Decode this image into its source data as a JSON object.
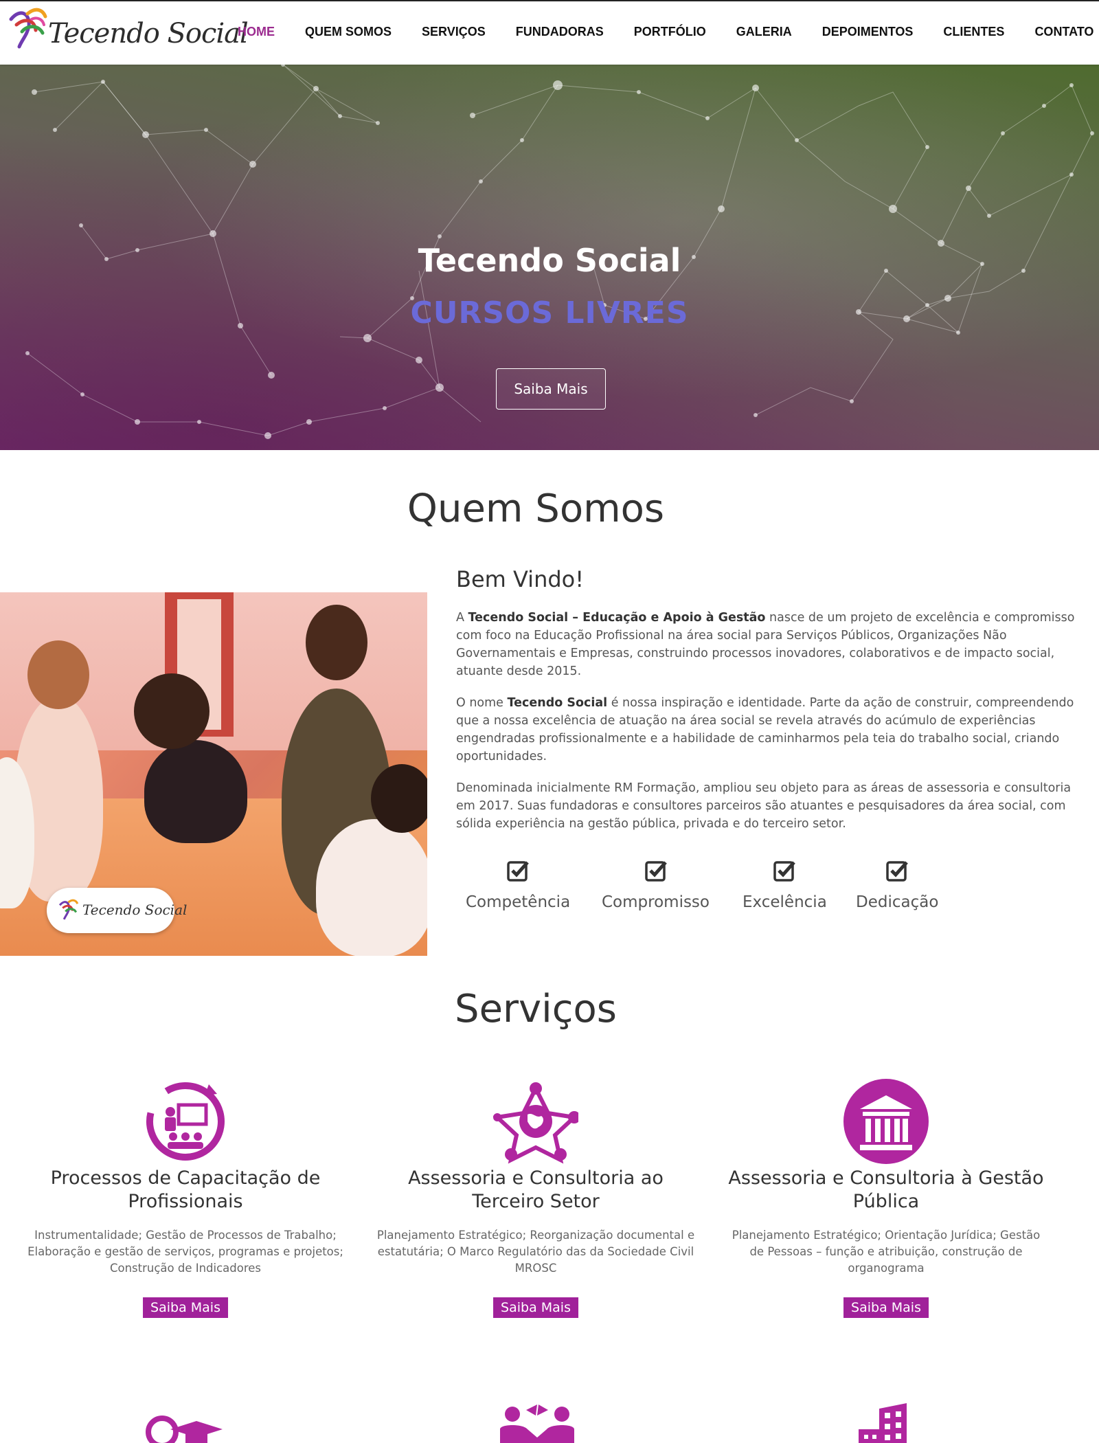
{
  "brand": {
    "name": "Tecendo Social",
    "accent": "#9b2b8f",
    "button_color": "#a0219a",
    "hero_sub_color": "#6b6ad8"
  },
  "nav": {
    "items": [
      {
        "label": "HOME",
        "active": true
      },
      {
        "label": "QUEM SOMOS",
        "active": false
      },
      {
        "label": "SERVIÇOS",
        "active": false
      },
      {
        "label": "FUNDADORAS",
        "active": false
      },
      {
        "label": "PORTFÓLIO",
        "active": false
      },
      {
        "label": "GALERIA",
        "active": false
      },
      {
        "label": "DEPOIMENTOS",
        "active": false
      },
      {
        "label": "CLIENTES",
        "active": false
      },
      {
        "label": "CONTATO",
        "active": false
      }
    ]
  },
  "hero": {
    "title": "Tecendo Social",
    "subtitle": "CURSOS LIVRES",
    "button": "Saiba Mais"
  },
  "quem_somos": {
    "title": "Quem Somos",
    "image_logo": "Tecendo Social",
    "welcome": "Bem Vindo!",
    "p1_pre": "A ",
    "p1_bold": "Tecendo Social – Educação e Apoio à Gestão",
    "p1_post": " nasce de um projeto de excelência e compromisso com foco na Educação Profissional na área social para Serviços Públicos, Organizações Não Governamentais e Empresas, construindo processos inovadores, colaborativos e de impacto social, atuante desde 2015.",
    "p2_pre": "O nome ",
    "p2_bold": "Tecendo Social",
    "p2_post": " é nossa inspiração e identidade. Parte da ação de construir, compreendendo que a nossa excelência de atuação na área social se revela através do acúmulo de experiências engendradas profissionalmente e a habilidade de caminharmos pela teia do trabalho social, criando oportunidades.",
    "p3": "Denominada inicialmente RM Formação, ampliou seu objeto para as áreas de assessoria e consultoria em 2017. Suas fundadoras e consultores parceiros são atuantes e pesquisadores da área social, com sólida experiência na gestão pública, privada e do terceiro setor.",
    "values": [
      "Competência",
      "Compromisso",
      "Excelência",
      "Dedicação"
    ]
  },
  "servicos": {
    "title": "Serviços",
    "items": [
      {
        "icon": "presentation-icon",
        "title": "Processos de Capacitação de Profissionais",
        "desc": "Instrumentalidade; Gestão de Processos de Trabalho; Elaboração e gestão de serviços, programas e projetos; Construção de Indicadores",
        "button": "Saiba Mais"
      },
      {
        "icon": "globe-people-icon",
        "title": "Assessoria e Consultoria ao Terceiro Setor",
        "desc": "Planejamento Estratégico; Reorganização documental e estatutária; O Marco Regulatório das da Sociedade Civil MROSC",
        "button": "Saiba Mais"
      },
      {
        "icon": "government-building-icon",
        "title": "Assessoria e Consultoria à Gestão Pública",
        "desc": "Planejamento Estratégico; Orientação Jurídica; Gestão de Pessoas – função e atribuição, construção de organograma",
        "button": "Saiba Mais"
      }
    ]
  }
}
